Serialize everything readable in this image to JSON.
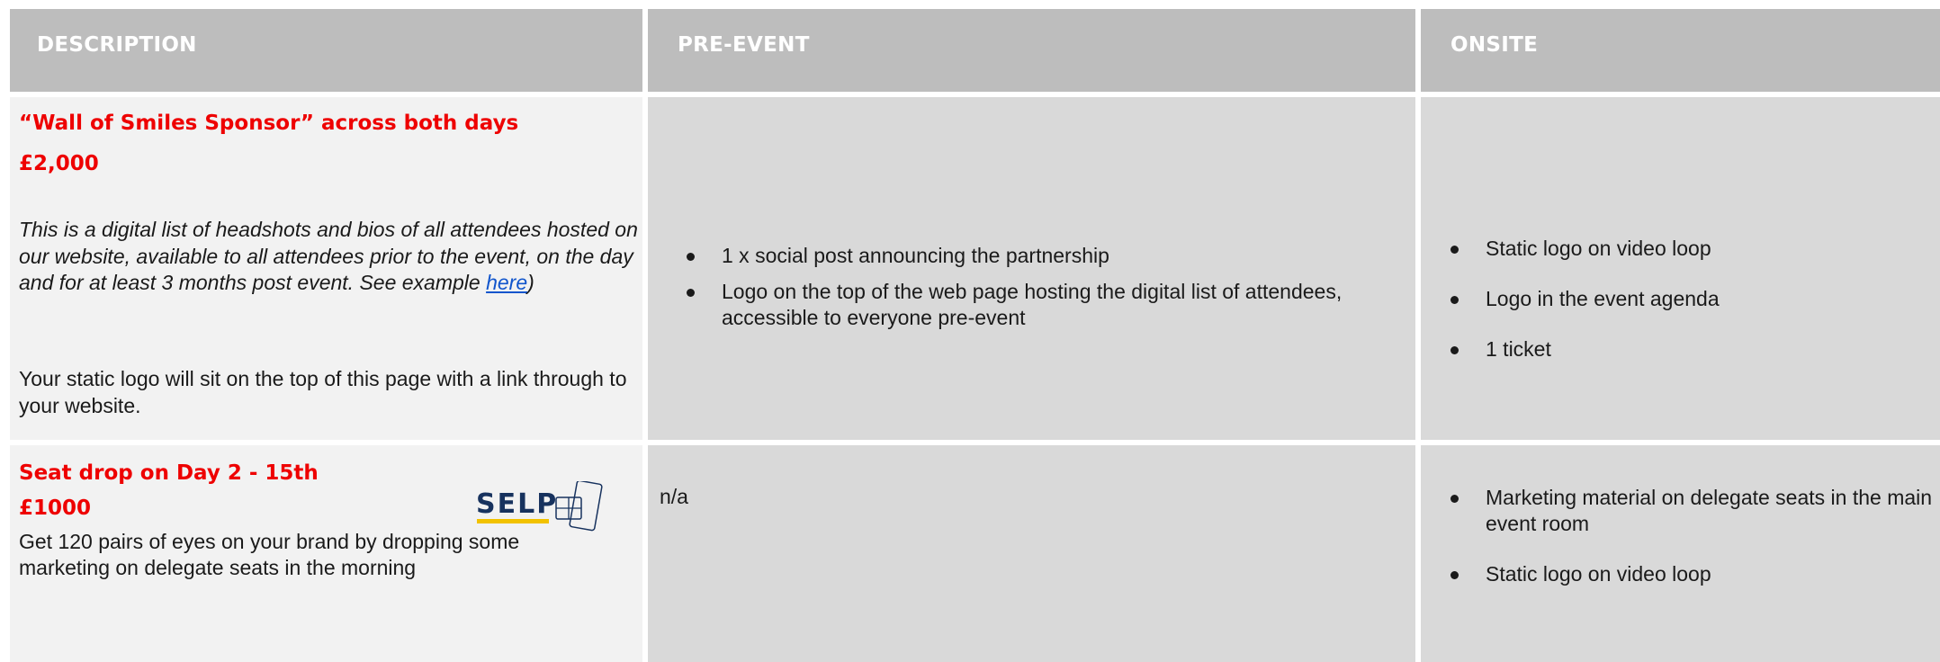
{
  "header": {
    "description": "DESCRIPTION",
    "pre_event": "PRE-EVENT",
    "onsite": "ONSITE"
  },
  "row1": {
    "title": "“Wall of Smiles Sponsor” across both days",
    "price": "£2,000",
    "italic_before_link": "This is a digital list of headshots and bios of all attendees hosted on our website, available to all attendees prior to the event, on the day and for at least 3 months post event.   See example ",
    "link_text": "here",
    "italic_after_link": ")",
    "body": "Your static logo will sit on the top of this page with a link through to your website.",
    "pre_event": [
      "1 x social post announcing the partnership",
      "Logo on the top of the web page hosting the digital list of attendees, accessible to everyone pre-event"
    ],
    "onsite": [
      "Static logo on video loop",
      "Logo in the event agenda",
      "1 ticket"
    ]
  },
  "row2": {
    "title": "Seat drop on Day 2 - 15th",
    "price": "£1000",
    "body": "Get 120 pairs of eyes on your brand by dropping some marketing on delegate seats in the morning",
    "logo_text": "SELP",
    "pre_event": "n/a",
    "onsite": [
      "Marketing material on delegate seats in the main event room",
      "Static logo on video loop"
    ]
  },
  "colors": {
    "header_bg": "#bdbdbd",
    "accent_red": "#ee0000",
    "desc_bg": "#f2f2f2",
    "cell_bg": "#d9d9d9",
    "logo_navy": "#17325e",
    "logo_yellow": "#f2c200"
  }
}
